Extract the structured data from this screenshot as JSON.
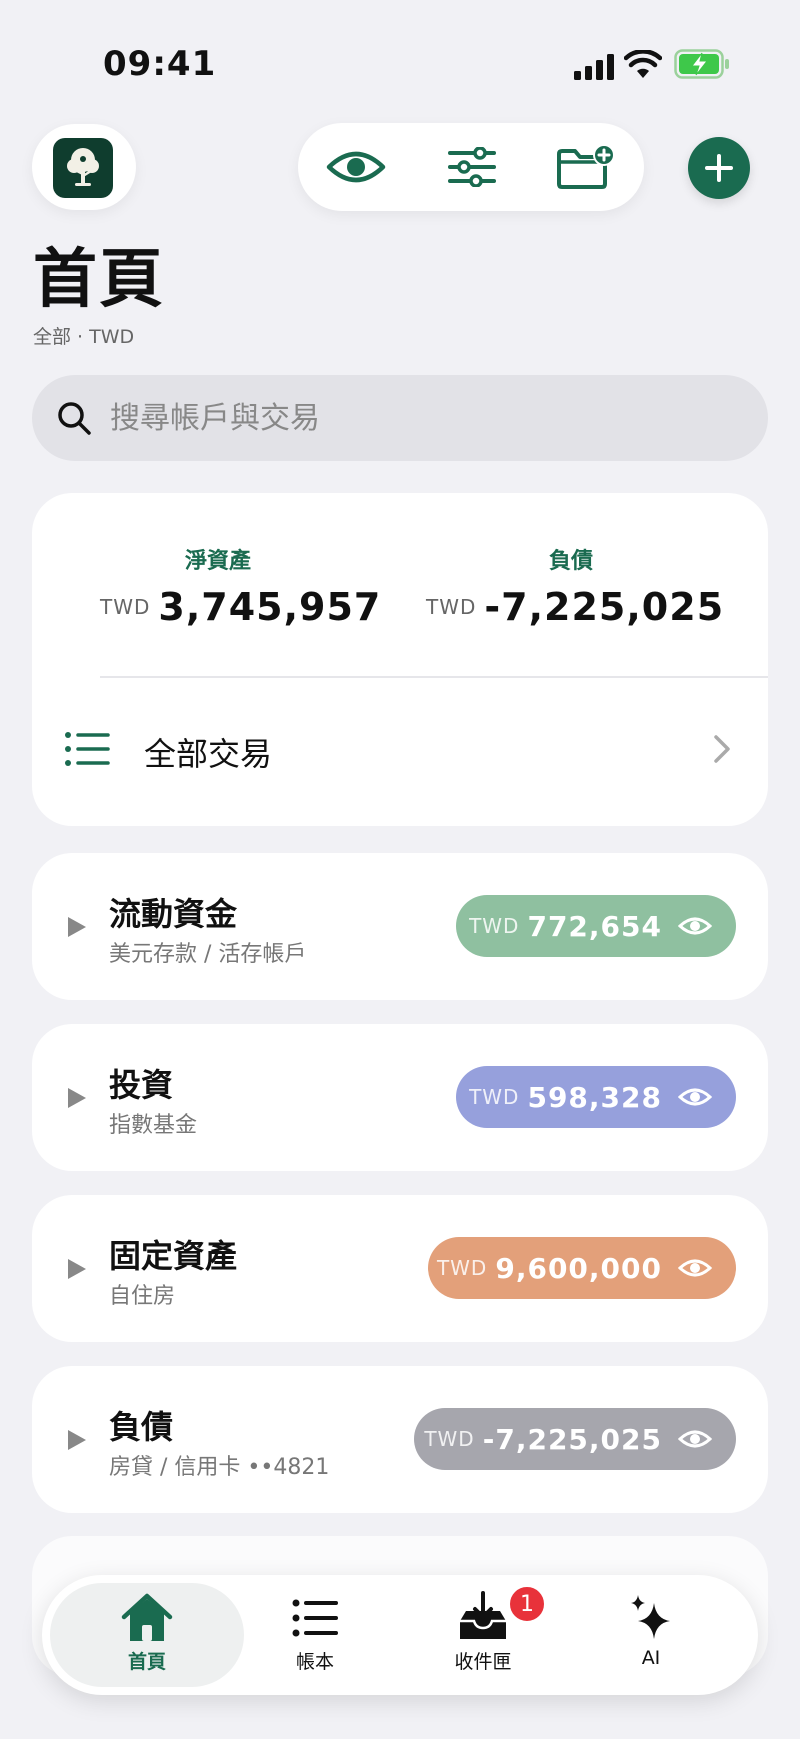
{
  "status_bar": {
    "time": "09:41"
  },
  "toolbar": {
    "app_logo_icon": "tree-logo-icon",
    "visibility_icon": "eye-icon",
    "filter_icon": "sliders-icon",
    "new_folder_icon": "folder-add-icon",
    "add_icon": "plus-icon"
  },
  "header": {
    "title": "首頁",
    "subtitle": "全部 · TWD"
  },
  "search": {
    "placeholder": "搜尋帳戶與交易"
  },
  "summary": {
    "net_worth": {
      "label": "淨資產",
      "currency": "TWD",
      "value": "3,745,957"
    },
    "liabilities": {
      "label": "負債",
      "currency": "TWD",
      "value": "-7,225,025"
    },
    "all_transactions_label": "全部交易"
  },
  "groups": [
    {
      "name": "流動資金",
      "subtitle": "美元存款 / 活存帳戶",
      "currency": "TWD",
      "value": "772,654",
      "color": "#8fc0a0"
    },
    {
      "name": "投資",
      "subtitle": "指數基金",
      "currency": "TWD",
      "value": "598,328",
      "color": "#96a0dc"
    },
    {
      "name": "固定資產",
      "subtitle": "自住房",
      "currency": "TWD",
      "value": "9,600,000",
      "color": "#e3a07a"
    },
    {
      "name": "負債",
      "subtitle": "房貸 / 信用卡 ••4821",
      "currency": "TWD",
      "value": "-7,225,025",
      "color": "#a6a6ad"
    }
  ],
  "tabbar": {
    "home": "首頁",
    "ledger": "帳本",
    "inbox": "收件匣",
    "inbox_badge": "1",
    "ai": "AI"
  },
  "colors": {
    "accent": "#1a6b50",
    "background": "#f1f1f5",
    "badge": "#e8323a"
  }
}
